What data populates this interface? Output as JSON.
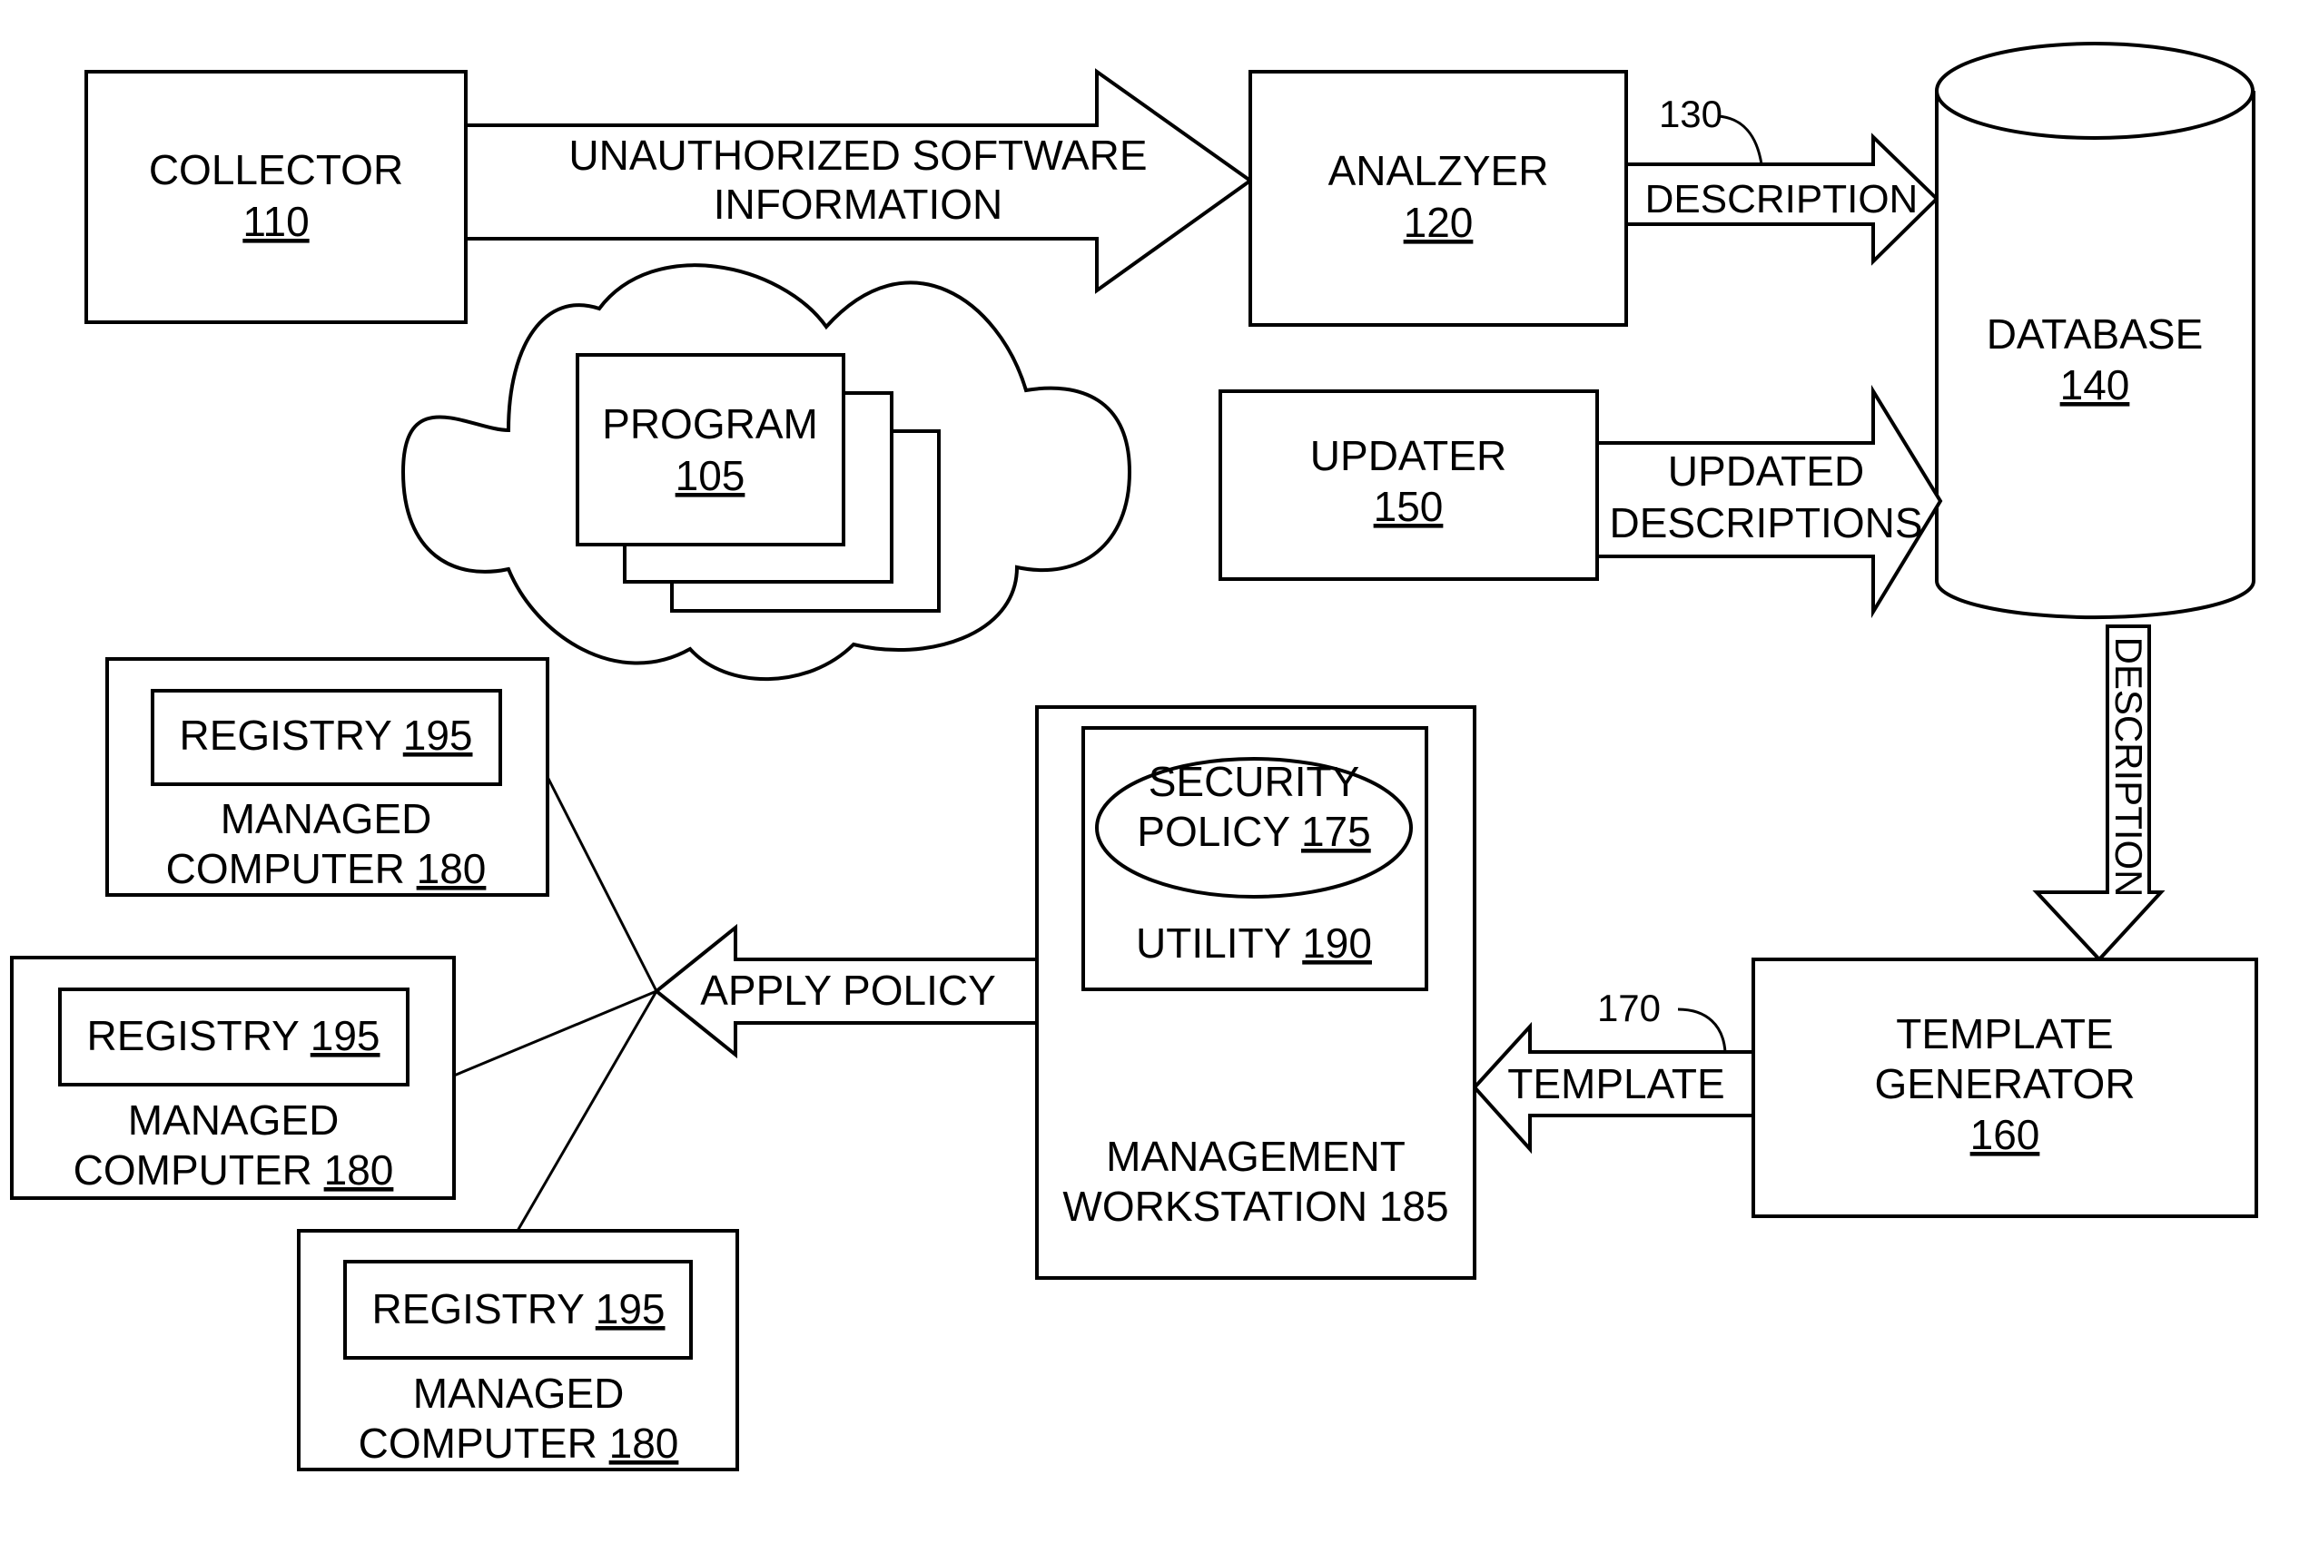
{
  "figure": {
    "nodes": {
      "collector": {
        "name": "COLLECTOR",
        "ref": "110"
      },
      "analyzer": {
        "name": "ANALZYER",
        "ref": "120"
      },
      "database": {
        "name": "DATABASE",
        "ref": "140"
      },
      "updater": {
        "name": "UPDATER",
        "ref": "150"
      },
      "template_generator": {
        "line1": "TEMPLATE",
        "line2": "GENERATOR",
        "ref": "160"
      },
      "program": {
        "name": "PROGRAM",
        "ref": "105"
      },
      "security_policy": {
        "line1": "SECURITY",
        "line2": "POLICY ",
        "ref": "175"
      },
      "utility": {
        "name": "UTILITY ",
        "ref": "190"
      },
      "management_workstation": {
        "line1": "MANAGEMENT",
        "line2": "WORKSTATION 185"
      },
      "managed_computers": [
        {
          "registry": "REGISTRY ",
          "registry_ref": "195",
          "line1": "MANAGED",
          "line2": "COMPUTER ",
          "ref": "180"
        },
        {
          "registry": "REGISTRY ",
          "registry_ref": "195",
          "line1": "MANAGED",
          "line2": "COMPUTER ",
          "ref": "180"
        },
        {
          "registry": "REGISTRY ",
          "registry_ref": "195",
          "line1": "MANAGED",
          "line2": "COMPUTER ",
          "ref": "180"
        }
      ]
    },
    "arrows": {
      "unauthorized": {
        "line1": "UNAUTHORIZED SOFTWARE",
        "line2": "INFORMATION"
      },
      "description_130": {
        "label": "DESCRIPTION",
        "ref": "130"
      },
      "updated": {
        "line1": "UPDATED",
        "line2": "DESCRIPTIONS"
      },
      "description_down": {
        "label": "DESCRIPTION"
      },
      "template_170": {
        "label": "TEMPLATE",
        "ref": "170"
      },
      "apply_policy": {
        "label": "APPLY POLICY"
      }
    }
  }
}
